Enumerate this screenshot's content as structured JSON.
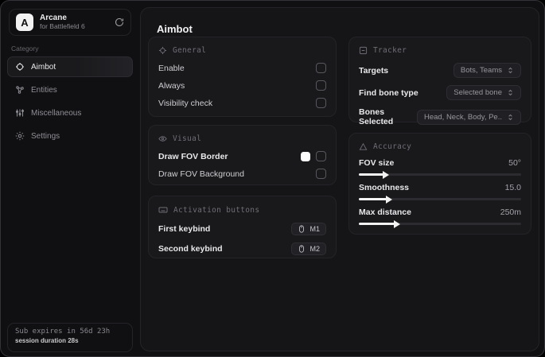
{
  "app": {
    "logo_letter": "A",
    "title": "Arcane",
    "subtitle": "for Battlefield 6"
  },
  "sidebar": {
    "category_label": "Category",
    "items": [
      {
        "label": "Aimbot"
      },
      {
        "label": "Entities"
      },
      {
        "label": "Miscellaneous"
      },
      {
        "label": "Settings"
      }
    ],
    "footer": {
      "line1": "Sub expires in 56d 23h",
      "line2": "session duration 28s"
    }
  },
  "main": {
    "title": "Aimbot",
    "general": {
      "title": "General",
      "rows": [
        {
          "label": "Enable",
          "checked": false
        },
        {
          "label": "Always",
          "checked": false
        },
        {
          "label": "Visibility check",
          "checked": false
        }
      ]
    },
    "visual": {
      "title": "Visual",
      "rows": [
        {
          "label": "Draw FOV Border",
          "color": "#ffffff",
          "checked": false
        },
        {
          "label": "Draw FOV Background",
          "checked": false
        }
      ]
    },
    "activation": {
      "title": "Activation buttons",
      "rows": [
        {
          "label": "First keybind",
          "key": "M1"
        },
        {
          "label": "Second keybind",
          "key": "M2"
        }
      ]
    },
    "tracker": {
      "title": "Tracker",
      "rows": [
        {
          "label": "Targets",
          "value": "Bots, Teams"
        },
        {
          "label": "Find bone type",
          "value": "Selected bone"
        },
        {
          "label": "Bones Selected",
          "value": "Head, Neck, Body, Pe.."
        }
      ]
    },
    "accuracy": {
      "title": "Accuracy",
      "sliders": [
        {
          "label": "FOV size",
          "value": "50°",
          "fill_pct": 15
        },
        {
          "label": "Smoothness",
          "value": "15.0",
          "fill_pct": 17
        },
        {
          "label": "Max distance",
          "value": "250m",
          "fill_pct": 22
        }
      ]
    }
  },
  "colors": {
    "accent": "#f2f2f2",
    "card_bg": "#19191c",
    "panel_bg": "#151517"
  }
}
